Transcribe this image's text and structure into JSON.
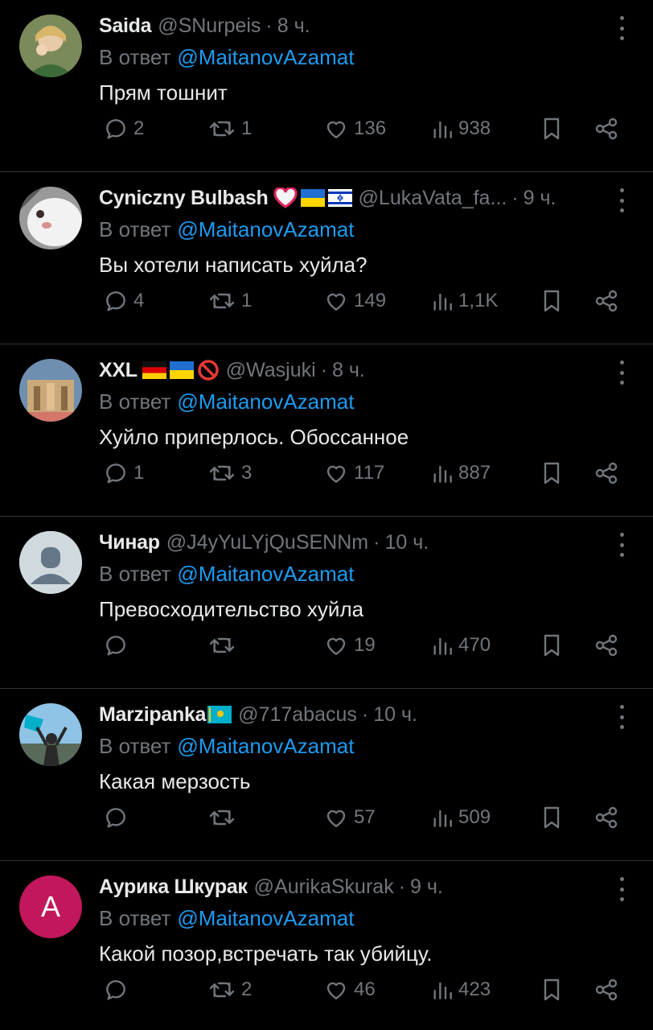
{
  "reply_prefix": "В ответ",
  "tweets": [
    {
      "name": "Saida",
      "handle": "@SNurpeis",
      "time": "8 ч.",
      "reply_to": "@MaitanovAzamat",
      "text": "Прям тошнит",
      "replies": "2",
      "retweets": "1",
      "likes": "136",
      "views": "938",
      "flags": []
    },
    {
      "name": "Cyniczny Bulbash",
      "handle": "@LukaVata_fa...",
      "time": "9 ч.",
      "reply_to": "@MaitanovAzamat",
      "text": "Вы хотели написать хуйла?",
      "replies": "4",
      "retweets": "1",
      "likes": "149",
      "views": "1,1K",
      "flags": [
        "heart",
        "ua",
        "il"
      ]
    },
    {
      "name": "XXL",
      "handle": "@Wasjuki",
      "time": "8 ч.",
      "reply_to": "@MaitanovAzamat",
      "text": "Хуйло приперлось. Обоссанное",
      "replies": "1",
      "retweets": "3",
      "likes": "117",
      "views": "887",
      "flags": [
        "de",
        "ua",
        "prohibited"
      ]
    },
    {
      "name": "Чинар",
      "handle": "@J4yYuLYjQuSENNm",
      "time": "10 ч.",
      "reply_to": "@MaitanovAzamat",
      "text": "Превосходительство хуйла",
      "replies": "",
      "retweets": "",
      "likes": "19",
      "views": "470",
      "flags": []
    },
    {
      "name": "Marzipanka",
      "handle": "@717abacus",
      "time": "10 ч.",
      "reply_to": "@MaitanovAzamat",
      "text": "Какая мерзость",
      "replies": "",
      "retweets": "",
      "likes": "57",
      "views": "509",
      "flags": [
        "kz"
      ]
    },
    {
      "name": "Аурика Шкурак",
      "handle": "@AurikaSkurak",
      "time": "9 ч.",
      "reply_to": "@MaitanovAzamat",
      "text": "Какой позор,встречать так убийцу.",
      "replies": "",
      "retweets": "2",
      "likes": "46",
      "views": "423",
      "flags": [],
      "avatar_letter": "A"
    }
  ],
  "colors": {
    "background": "#000000",
    "text": "#e7e9ea",
    "muted": "#71767b",
    "accent": "#1d9bf0",
    "divider": "#2f3336"
  }
}
